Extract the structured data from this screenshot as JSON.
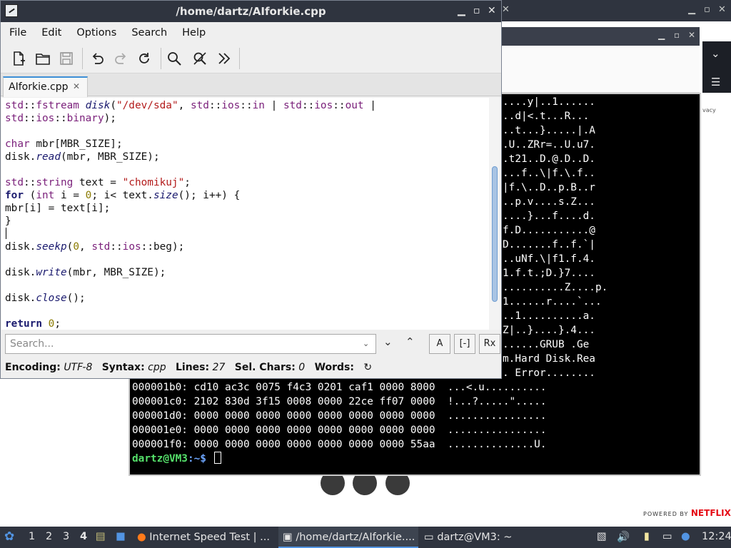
{
  "editor": {
    "title": "/home/dartz/AIforkie.cpp",
    "menu": [
      "File",
      "Edit",
      "Options",
      "Search",
      "Help"
    ],
    "tab_label": "AIforkie.cpp",
    "search_placeholder": "Search...",
    "search_buttons": {
      "match_case": "A",
      "whole_word": "[-]",
      "regex": "Rx"
    },
    "status": {
      "encoding_label": "Encoding:",
      "encoding": "UTF-8",
      "syntax_label": "Syntax:",
      "syntax": "cpp",
      "lines_label": "Lines:",
      "lines": "27",
      "sel_label": "Sel. Chars:",
      "sel": "0",
      "words_label": "Words:"
    }
  },
  "terminal": {
    "ascii_rows": [
      "....y|..1......",
      "..d|<.t...R...",
      "..t...}.....|.A",
      ".U..ZRr=..U.u7.",
      ".t21..D.@.D..D.",
      "...f..\\|f.\\.f..",
      "|f.\\..D..p.B..r",
      "..p.v....s.Z...",
      "....}...f....d.",
      "f.D...........@",
      "D.......f..f.`|",
      "..uNf.\\|f1.f.4.",
      "1.f.t.;D.}7....",
      "..........Z....p.",
      "1......r....`...",
      "..1..........a.",
      "Z|..}....}.4...",
      "......GRUB .Ge",
      "m.Hard Disk.Rea",
      ". Error........"
    ],
    "hex_rows": [
      "000001b0: cd10 ac3c 0075 f4c3 0201 caf1 0000 8000  ...<.u..........",
      "000001c0: 2102 830d 3f15 0008 0000 22ce ff07 0000  !...?.....\".....",
      "000001d0: 0000 0000 0000 0000 0000 0000 0000 0000  ................",
      "000001e0: 0000 0000 0000 0000 0000 0000 0000 0000  ................",
      "000001f0: 0000 0000 0000 0000 0000 0000 0000 55aa  ..............U."
    ],
    "prompt_user": "dartz@VM3",
    "prompt_path": ":~$"
  },
  "background": {
    "privacy_text": "vacy",
    "powered_by": "POWERED BY",
    "netflix": "NETFLIX"
  },
  "taskbar": {
    "workspaces": [
      "1",
      "2",
      "3",
      "4"
    ],
    "tasks": [
      "Internet Speed Test | ...",
      "/home/dartz/AIforkie....",
      "dartz@VM3: ~"
    ],
    "clock": "12:24"
  },
  "colors": {
    "titlebar": "#2f343f",
    "taskbar": "#2f343f",
    "accent": "#5294e2",
    "prompt_user": "#55e06a",
    "prompt_path": "#6da6ff"
  }
}
